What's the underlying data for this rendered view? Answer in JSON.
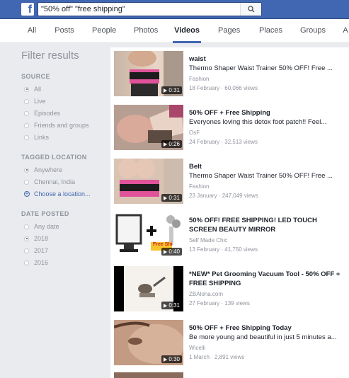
{
  "search": {
    "value": "\"50% off\" \"free shipping\""
  },
  "tabs": [
    {
      "label": "All"
    },
    {
      "label": "Posts"
    },
    {
      "label": "People"
    },
    {
      "label": "Photos"
    },
    {
      "label": "Videos"
    },
    {
      "label": "Pages"
    },
    {
      "label": "Places"
    },
    {
      "label": "Groups"
    },
    {
      "label": "A"
    }
  ],
  "filters": {
    "title": "Filter results",
    "source": {
      "heading": "SOURCE",
      "options": [
        "All",
        "Live",
        "Episodes",
        "Friends and groups",
        "Links"
      ]
    },
    "location": {
      "heading": "TAGGED LOCATION",
      "options": [
        "Anywhere",
        "Chennai, India"
      ],
      "choose": "Choose a location..."
    },
    "date": {
      "heading": "DATE POSTED",
      "options": [
        "Any date",
        "2018",
        "2017",
        "2016"
      ]
    }
  },
  "results": [
    {
      "title": "waist",
      "desc": "Thermo Shaper Waist Trainer 50% OFF! Free ...",
      "source": "Fashion",
      "meta": "18 February · 60,066 views",
      "duration": "0:31"
    },
    {
      "title": "50% OFF + Free Shipping",
      "desc": "Everyones loving this detox foot patch!! Feel...",
      "source": "OsF",
      "meta": "24 February · 32,513 views",
      "duration": "0:26"
    },
    {
      "title": "Belt",
      "desc": "Thermo Shaper Waist Trainer 50% OFF! Free ...",
      "source": "Fashion",
      "meta": "23 January · 247,049 views",
      "duration": "0:31"
    },
    {
      "title": "50% OFF! FREE SHIPPING! LED TOUCH SCREEN BEAUTY MIRROR",
      "source": "Self Made Chic",
      "meta": "13 February · 41,750 views",
      "duration": "0:40",
      "thumb_text": "Free Shi"
    },
    {
      "title": "*NEW* Pet Grooming Vacuum Tool - 50% OFF + FREE SHIPPING",
      "source": "ZBAloha.com",
      "meta": "27 February · 139 views",
      "duration": "0:31"
    },
    {
      "title": "50% OFF + Free Shipping Today",
      "desc": "Be more young and beautiful in just 5 minutes a...",
      "source": "Wicelli",
      "meta": "1 March · 2,891 views",
      "duration": "0:30"
    }
  ]
}
